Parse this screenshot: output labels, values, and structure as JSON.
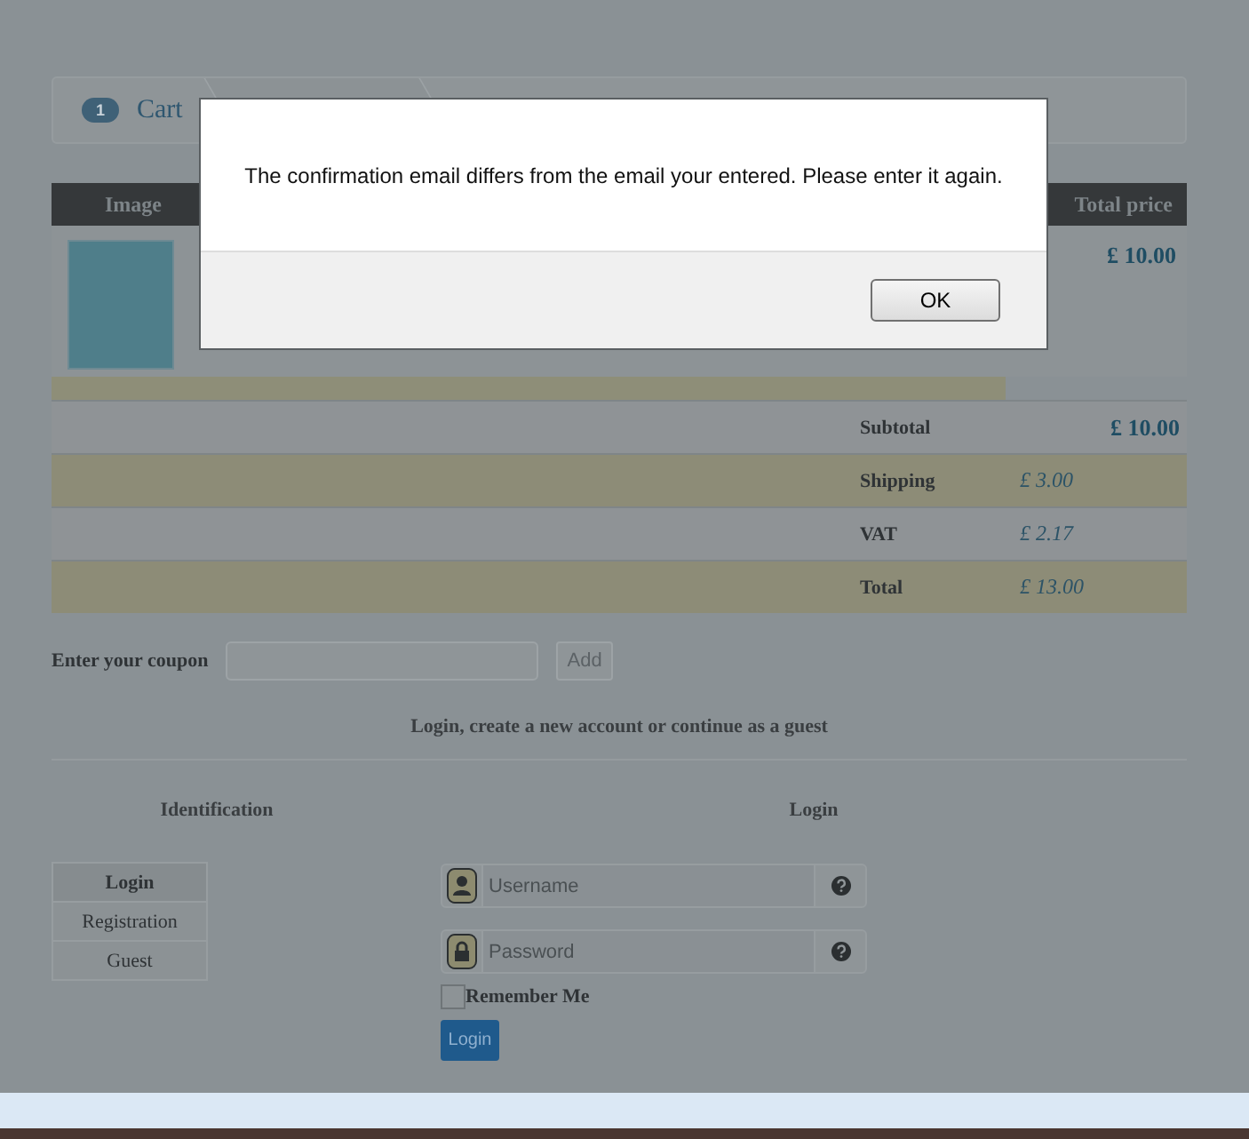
{
  "breadcrumb": {
    "step_number": "1",
    "label": "Cart"
  },
  "cart_table": {
    "columns": [
      "Image",
      "Total price"
    ],
    "rows": [
      {
        "price": "£ 10.00"
      }
    ]
  },
  "summary": [
    {
      "label": "Subtotal",
      "value": "£ 10.00",
      "kind": "strong"
    },
    {
      "label": "Shipping",
      "value": "£ 3.00",
      "kind": "italic"
    },
    {
      "label": "VAT",
      "value": "£ 2.17",
      "kind": "italic"
    },
    {
      "label": "Total",
      "value": "£ 13.00",
      "kind": "italic"
    }
  ],
  "coupon": {
    "label": "Enter your coupon",
    "button": "Add"
  },
  "login_intro": "Login, create a new account or continue as a guest",
  "identification": {
    "heading": "Identification",
    "tabs": [
      {
        "label": "Login",
        "selected": true
      },
      {
        "label": "Registration",
        "selected": false
      },
      {
        "label": "Guest",
        "selected": false
      }
    ]
  },
  "login": {
    "heading": "Login",
    "username_placeholder": "Username",
    "password_placeholder": "Password",
    "remember": {
      "label": "Remember Me",
      "checked": false
    },
    "button": "Login"
  },
  "dialog": {
    "message": "The confirmation email differs from the email your entered. Please enter it again.",
    "button": "OK"
  }
}
